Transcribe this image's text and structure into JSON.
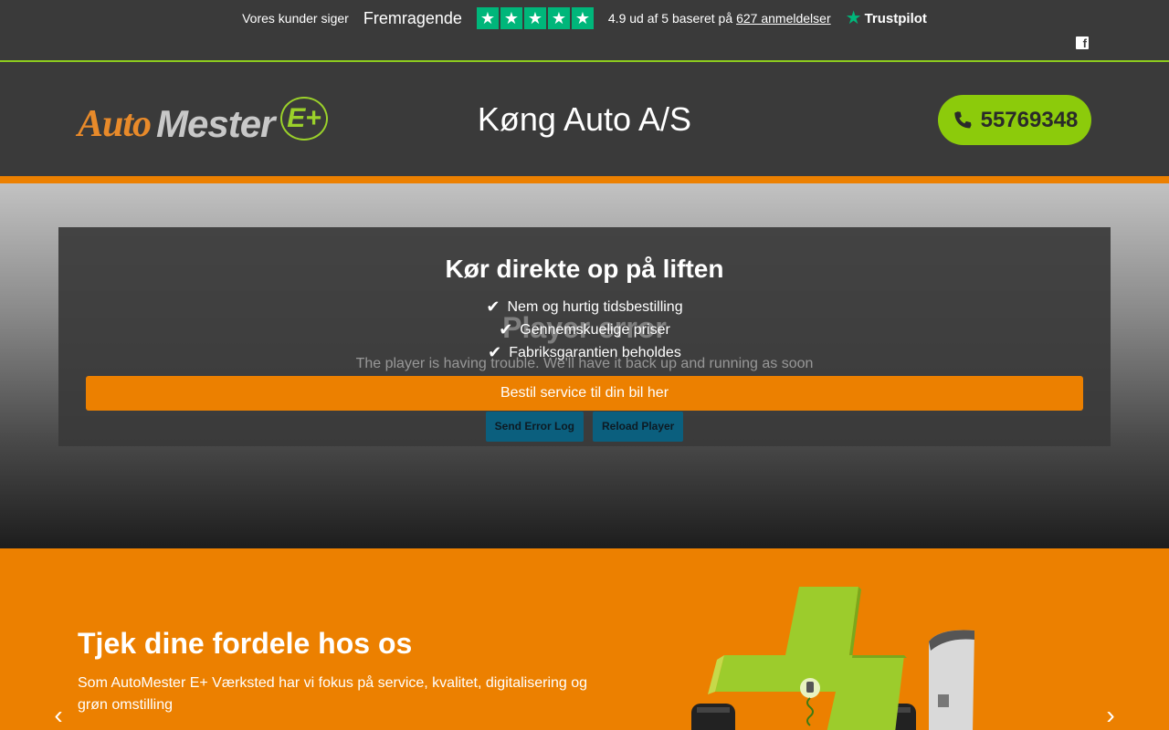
{
  "trustpilot": {
    "customers_say": "Vores kunder siger",
    "rating_word": "Fremragende",
    "stars": 5,
    "score_text": "4.9 ud af 5 baseret på",
    "reviews_link": "627 anmeldelser",
    "brand": "Trustpilot"
  },
  "header": {
    "logo": {
      "part1": "Auto",
      "part2": "Mester",
      "part3": "E+"
    },
    "company_name": "Køng Auto A/S",
    "phone": "55769348"
  },
  "hero": {
    "title": "Kør direkte op på liften",
    "features": [
      "Nem og hurtig tidsbestilling",
      "Gennemskuelige priser",
      "Fabriksgarantien beholdes"
    ],
    "cta": "Bestil service til din bil her",
    "player_error_title": "Player error",
    "player_error_msg": "The player is having trouble. We'll have it back up and running as soon",
    "send_error_log": "Send Error Log",
    "reload_player": "Reload Player"
  },
  "promo": {
    "title": "Tjek dine fordele hos os",
    "text": "Som AutoMester E+ Værksted har vi fokus på service, kvalitet, digitalisering og grøn omstilling"
  },
  "colors": {
    "brand_orange": "#ec8000",
    "brand_green": "#8ccb0b",
    "trustpilot_green": "#00b67a",
    "dark_bg": "#3a3a3a"
  },
  "icons": [
    "facebook-icon",
    "phone-icon",
    "check-icon",
    "trustpilot-star-icon",
    "arrow-left-icon",
    "arrow-right-icon"
  ]
}
